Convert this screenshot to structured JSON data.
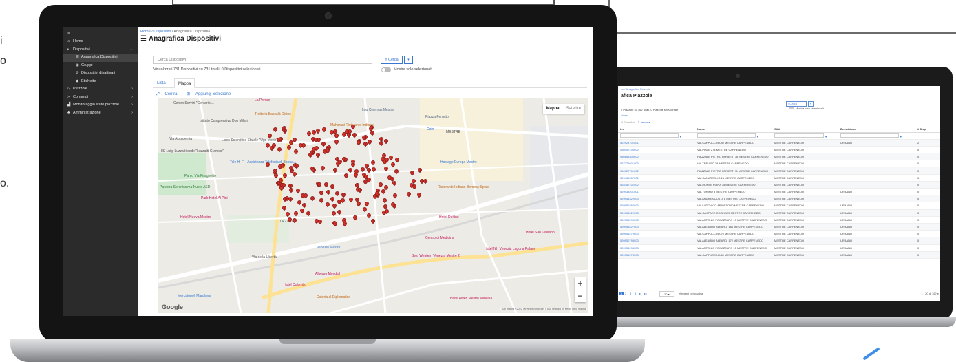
{
  "edge_text": [
    "i",
    "o",
    "o."
  ],
  "big_screen": {
    "sidebar": {
      "menu_icon": "≡",
      "items": [
        {
          "label": "Home",
          "icon": "home-icon",
          "glyph": "⌂",
          "level": 0,
          "chevron": ""
        },
        {
          "label": "Dispositivi",
          "icon": "device-icon",
          "glyph": "▪",
          "level": 0,
          "chevron": "⌄"
        },
        {
          "label": "Anagrafica Dispositivi",
          "icon": "list-icon",
          "glyph": "☰",
          "level": 1,
          "chevron": "",
          "active": true
        },
        {
          "label": "Gruppi",
          "icon": "group-icon",
          "glyph": "◉",
          "level": 1,
          "chevron": ""
        },
        {
          "label": "Dispositivi disattivati",
          "icon": "disabled-icon",
          "glyph": "⊘",
          "level": 1,
          "chevron": ""
        },
        {
          "label": "Etichette",
          "icon": "tag-icon",
          "glyph": "◆",
          "level": 1,
          "chevron": ""
        },
        {
          "label": "Piazzole",
          "icon": "pin-icon",
          "glyph": "⊙",
          "level": 0,
          "chevron": "›"
        },
        {
          "label": "Comandi",
          "icon": "terminal-icon",
          "glyph": ">_",
          "level": 0,
          "chevron": "›"
        },
        {
          "label": "Monitoraggio stato piazzole",
          "icon": "chart-icon",
          "glyph": "▟",
          "level": 0,
          "chevron": "›"
        },
        {
          "label": "Amministrazione",
          "icon": "admin-icon",
          "glyph": "♣",
          "level": 0,
          "chevron": "›"
        }
      ]
    },
    "breadcrumb": {
      "home": "Home",
      "sep": "/",
      "section": "Dispositivi",
      "current": "Anagrafica Dispositivi"
    },
    "title": "Anagrafica Dispositivi",
    "collapse_glyph": "»",
    "search": {
      "placeholder": "Cerca Dispositivi",
      "button": "Cerca",
      "caret": "▾"
    },
    "info": "Visualizzati 731 Dispositivi su 731 totali. 0 Dispositivi selezionati",
    "toggle_label": "Mostra solo selezionati",
    "tabs": [
      "Lista",
      "Mappa"
    ],
    "map_tools": [
      "Centra",
      "Aggiungi Selezione"
    ],
    "map": {
      "type_buttons": [
        "Mappa",
        "Satellite"
      ],
      "zoom_in": "+",
      "zoom_out": "−",
      "logo": "Google",
      "attribution": "Dati mappa ©2022   Termini e condizioni d'uso   Segnala un errore nella mappa",
      "labels": [
        {
          "text": "Centro Servizi \"Contarini...",
          "color": "#555"
        },
        {
          "text": "Trattoria Baccalà Divino",
          "color": "#c06a1a"
        },
        {
          "text": "Istituto Comprensivo Don Milani",
          "color": "#555"
        },
        {
          "text": "Img Cinemas Mestre",
          "color": "#5a6f88"
        },
        {
          "text": "Piazza Ferretto",
          "color": "#5a6f88"
        },
        {
          "text": "Maharani Ristorante Indiano",
          "color": "#c06a1a"
        },
        {
          "text": "Coin",
          "color": "#3a78d0"
        },
        {
          "text": "MESTRE",
          "color": "#444"
        },
        {
          "text": "Via Accademia",
          "color": "#555"
        },
        {
          "text": "Liceo Scientifico Statale \"Ugo Morin\"",
          "color": "#555"
        },
        {
          "text": "IIS Luigi Luzzatti sede \"Luzzatti Gramsci\"",
          "color": "#555"
        },
        {
          "text": "Tele Hi-Fi - Assistenza Telefonia di Bonna...",
          "color": "#3a78d0"
        },
        {
          "text": "Parco Via Piraghetto",
          "color": "#2e7d3a"
        },
        {
          "text": "Hostage Europa Mestre",
          "color": "#3a78d0"
        },
        {
          "text": "Palestra Serenissima Nuoto ASD",
          "color": "#2e7d3a"
        },
        {
          "text": "Park Hotel Ai Pini",
          "color": "#c2185b"
        },
        {
          "text": "Ristorante Indiano Bombay Spice",
          "color": "#c06a1a"
        },
        {
          "text": "Hotel Nuova Mestre",
          "color": "#c2185b"
        },
        {
          "text": "1AG Club",
          "color": "#555"
        },
        {
          "text": "Hotel Delfino",
          "color": "#c2185b"
        },
        {
          "text": "Hotel San Giuliano",
          "color": "#c2185b"
        },
        {
          "text": "Centro di Medicina",
          "color": "#c2185b"
        },
        {
          "text": "Venezia Mestre",
          "color": "#3a78d0"
        },
        {
          "text": "Hotel NH Venezia Laguna Palace",
          "color": "#c2185b"
        },
        {
          "text": "Best Western Venezia Mestre 2",
          "color": "#c2185b"
        },
        {
          "text": "Via della Libertà",
          "color": "#555"
        },
        {
          "text": "Albergo Mondial",
          "color": "#c2185b"
        },
        {
          "text": "Hotel Colombo",
          "color": "#c2185b"
        },
        {
          "text": "Mercatopoli Marghera",
          "color": "#3a78d0"
        },
        {
          "text": "Osteria al Diplomatico",
          "color": "#c06a1a"
        },
        {
          "text": "Hotel Alveri Mestre Venezia",
          "color": "#c2185b"
        },
        {
          "text": "La Penice",
          "color": "#c2185b"
        }
      ],
      "marker_count_note": ""
    }
  },
  "small_screen": {
    "breadcrumb": "ne / Anagrafica Piazzole",
    "title": "afica Piazzole",
    "search_button": "Cerca",
    "info": "0 Piazzole su 162 totali. 0 Piazzole selezionate",
    "toggle_label": "Mostra solo selezionati",
    "link": "zione",
    "tools": [
      "Disattiva",
      "Importa"
    ],
    "columns": [
      "ivo",
      "Nome",
      "Città",
      "Descrizione",
      "# Disp."
    ],
    "rows": [
      [
        "522923701001",
        "VIA CAPPUCCINA 40 MESTRE CARPENEDO",
        "MESTRE CARPENEDO",
        "URBANO",
        "2"
      ],
      [
        "050402100002",
        "VIA PIAVE 274 MESTRE CARPENEDO",
        "MESTRE CARPENEDO",
        "",
        "0"
      ],
      [
        "950153300002",
        "PIAZZALE PIETRO PARIETTI 36 MESTRE CARPENEDO",
        "MESTRE CARPENEDO",
        "",
        "0"
      ],
      [
        "527776601003",
        "VIA TREVISO 38 MESTRE CARPENEDO",
        "MESTRE CARPENEDO",
        "",
        "0"
      ],
      [
        "950727701002",
        "PIAZZALE PIETRO PARIETTI 11 MESTRE CARPENEDO",
        "MESTRE CARPENEDO",
        "",
        "0"
      ],
      [
        "529466057001",
        "VIA CANAREGLIO 15 MESTRE CARPENEDO",
        "MESTRE CARPENEDO",
        "",
        "0"
      ],
      [
        "528757101002",
        "VIA MONTE PIANA 35 MESTRE CARPENEDO",
        "MESTRE CARPENEDO",
        "",
        "0"
      ],
      [
        "529933201001",
        "VIA TORINO 8 MESTRE CARPENEDO",
        "MESTRE CARPENEDO",
        "URBANO",
        "0"
      ],
      [
        "529944322003",
        "VIA ANDREA COSTA 8 MESTRE CARPENEDO",
        "MESTRE CARPENEDO",
        "",
        "0"
      ],
      [
        "520956364003",
        "VIA LUDOVICO ARIOSTO 60 MESTRE CARPENEDO",
        "MESTRE CARPENEDO",
        "URBANO",
        "0"
      ],
      [
        "520956222003",
        "VIA GASPARE GOZZI 125 MESTRE CARPENEDO",
        "MESTRE CARPENEDO",
        "URBANO",
        "0"
      ],
      [
        "520956296003",
        "VIA ANTONIO FOGAZZARO 13 MESTRE CARPENEDO",
        "MESTRE CARPENEDO",
        "URBANO",
        "0"
      ],
      [
        "520953227003",
        "VIA ALEARDO ALEARDI 184 MESTRE CARPENEDO",
        "MESTRE CARPENEDO",
        "URBANO",
        "0"
      ],
      [
        "520956270003",
        "VIA CAPPUCCINA 70 MESTRE CARPENEDO",
        "MESTRE CARPENEDO",
        "URBANO",
        "0"
      ],
      [
        "520950798003",
        "VIA ALEARDO ALEARDI 172 MESTRE CARPENEDO",
        "MESTRE CARPENEDO",
        "URBANO",
        "0"
      ],
      [
        "520956294003",
        "VIA ANTONIO FOGAZZARO 15 MESTRE CARPENEDO",
        "MESTRE CARPENEDO",
        "URBANO",
        "0"
      ],
      [
        "520956278003",
        "VIA CAPPUCCINA 60 MESTRE CARPENEDO",
        "MESTRE CARPENEDO",
        "URBANO",
        "0"
      ]
    ],
    "pager": {
      "pages": [
        "1",
        "2",
        "3",
        "4",
        "▸",
        "▸▸"
      ],
      "size": "20",
      "size_label": "elementi per pagina",
      "range": "1 - 20 di 162 e"
    }
  }
}
